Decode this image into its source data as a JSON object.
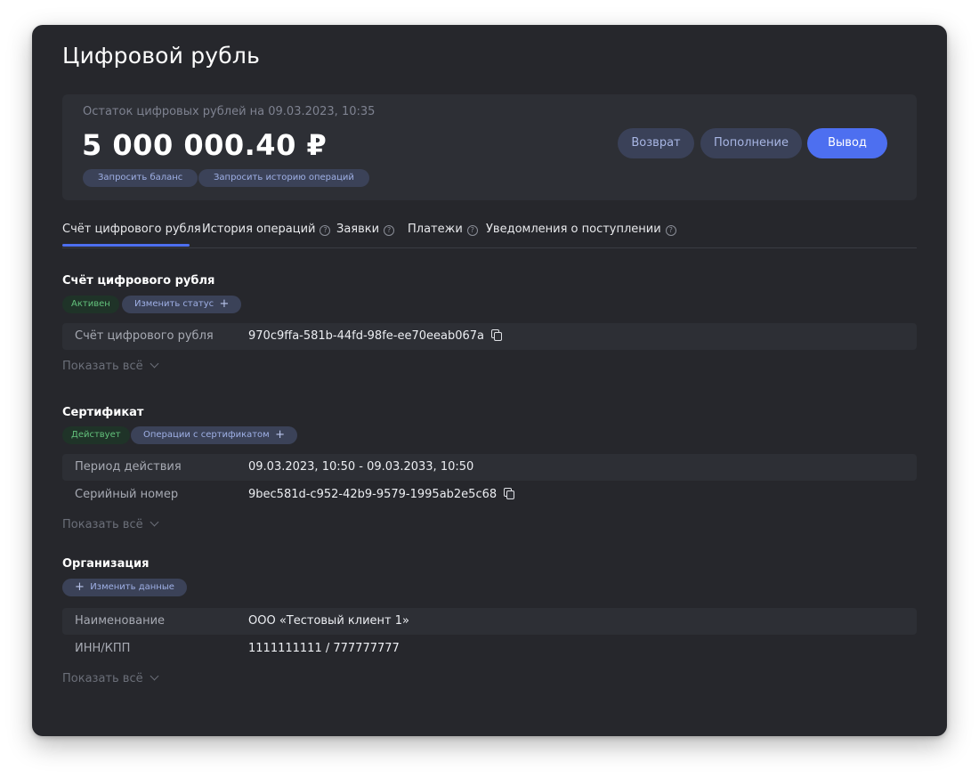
{
  "page": {
    "title": "Цифровой рубль"
  },
  "balance": {
    "caption": "Остаток цифровых рублей на 09.03.2023, 10:35",
    "amount": "5 000 000.40 ₽",
    "request_balance_label": "Запросить баланс",
    "request_history_label": "Запросить историю операций"
  },
  "actions": {
    "return_label": "Возврат",
    "topup_label": "Пополнение",
    "withdraw_label": "Вывод"
  },
  "tabs": [
    {
      "label": "Счёт цифрового рубля",
      "help": false,
      "active": true
    },
    {
      "label": "История операций",
      "help": true,
      "active": false
    },
    {
      "label": "Заявки",
      "help": true,
      "active": false
    },
    {
      "label": "Платежи",
      "help": true,
      "active": false
    },
    {
      "label": "Уведомления о поступлении",
      "help": true,
      "active": false
    }
  ],
  "help_glyph": "?",
  "account": {
    "title": "Счёт цифрового рубля",
    "status": "Активен",
    "change_status_label": "Изменить статус",
    "rows": [
      {
        "label": "Счёт цифрового рубля",
        "value": "970c9ffa-581b-44fd-98fe-ee70eeab067a"
      }
    ],
    "show_all_label": "Показать всё"
  },
  "certificate": {
    "title": "Сертификат",
    "status": "Действует",
    "operations_label": "Операции с сертификатом",
    "rows": [
      {
        "label": "Период действия",
        "value": "09.03.2023, 10:50 - 09.03.2033, 10:50"
      },
      {
        "label": "Серийный номер",
        "value": "9bec581d-c952-42b9-9579-1995ab2e5c68"
      }
    ],
    "show_all_label": "Показать всё"
  },
  "organization": {
    "title": "Организация",
    "edit_label": "Изменить данные",
    "rows": [
      {
        "label": "Наименование",
        "value": "ООО «Тестовый клиент 1»"
      },
      {
        "label": "ИНН/КПП",
        "value": "1111111111 / 777777777"
      }
    ],
    "show_all_label": "Показать всё"
  },
  "glyphs": {
    "plus": "+"
  },
  "colors": {
    "panel_bg": "#26272c",
    "card_bg": "#2d2f35",
    "accent": "#4d6ff0",
    "status_green": "#63c27c"
  }
}
